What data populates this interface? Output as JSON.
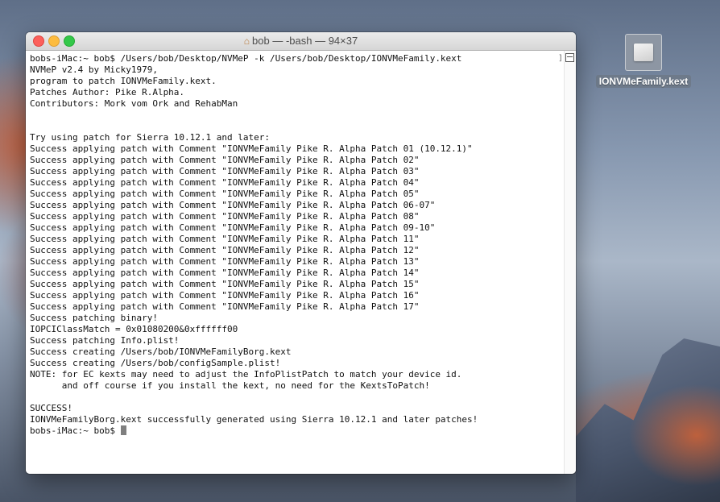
{
  "desktop": {
    "file_icon": {
      "name": "IONVMeFamily.kext",
      "icon": "kext-bundle-icon"
    }
  },
  "window": {
    "title": "bob — -bash — 94×37",
    "title_icon": "home-icon"
  },
  "terminal": {
    "lines": [
      "bobs-iMac:~ bob$ /Users/bob/Desktop/NVMeP -k /Users/bob/Desktop/IONVMeFamily.kext",
      "NVMeP v2.4 by Micky1979,",
      "program to patch IONVMeFamily.kext.",
      "Patches Author: Pike R.Alpha.",
      "Contributors: Mork vom Ork and RehabMan",
      "",
      "",
      "Try using patch for Sierra 10.12.1 and later:",
      "Success applying patch with Comment \"IONVMeFamily Pike R. Alpha Patch 01 (10.12.1)\"",
      "Success applying patch with Comment \"IONVMeFamily Pike R. Alpha Patch 02\"",
      "Success applying patch with Comment \"IONVMeFamily Pike R. Alpha Patch 03\"",
      "Success applying patch with Comment \"IONVMeFamily Pike R. Alpha Patch 04\"",
      "Success applying patch with Comment \"IONVMeFamily Pike R. Alpha Patch 05\"",
      "Success applying patch with Comment \"IONVMeFamily Pike R. Alpha Patch 06-07\"",
      "Success applying patch with Comment \"IONVMeFamily Pike R. Alpha Patch 08\"",
      "Success applying patch with Comment \"IONVMeFamily Pike R. Alpha Patch 09-10\"",
      "Success applying patch with Comment \"IONVMeFamily Pike R. Alpha Patch 11\"",
      "Success applying patch with Comment \"IONVMeFamily Pike R. Alpha Patch 12\"",
      "Success applying patch with Comment \"IONVMeFamily Pike R. Alpha Patch 13\"",
      "Success applying patch with Comment \"IONVMeFamily Pike R. Alpha Patch 14\"",
      "Success applying patch with Comment \"IONVMeFamily Pike R. Alpha Patch 15\"",
      "Success applying patch with Comment \"IONVMeFamily Pike R. Alpha Patch 16\"",
      "Success applying patch with Comment \"IONVMeFamily Pike R. Alpha Patch 17\"",
      "Success patching binary!",
      "IOPCIClassMatch = 0x01080200&0xffffff00",
      "Success patching Info.plist!",
      "Success creating /Users/bob/IONVMeFamilyBorg.kext",
      "Success creating /Users/bob/configSample.plist!",
      "NOTE: for EC kexts may need to adjust the InfoPlistPatch to match your device id.",
      "      and off course if you install the kext, no need for the KextsToPatch!",
      "",
      "SUCCESS!",
      "IONVMeFamilyBorg.kext successfully generated using Sierra 10.12.1 and later patches!"
    ],
    "prompt": "bobs-iMac:~ bob$ "
  }
}
